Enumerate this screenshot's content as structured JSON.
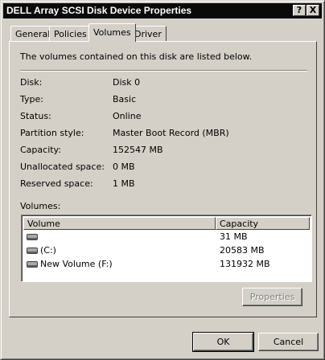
{
  "window": {
    "title": "DELL Array SCSI Disk Device Properties",
    "help_label": "?",
    "close_label": "X"
  },
  "tabs": [
    {
      "label": "General",
      "active": false
    },
    {
      "label": "Policies",
      "active": false
    },
    {
      "label": "Volumes",
      "active": true
    },
    {
      "label": "Driver",
      "active": false
    }
  ],
  "panel": {
    "intro": "The volumes contained on this disk are listed below.",
    "properties": [
      {
        "label": "Disk:",
        "value": "Disk 0"
      },
      {
        "label": "Type:",
        "value": "Basic"
      },
      {
        "label": "Status:",
        "value": "Online"
      },
      {
        "label": "Partition style:",
        "value": "Master Boot Record (MBR)"
      },
      {
        "label": "Capacity:",
        "value": "152547 MB"
      },
      {
        "label": "Unallocated space:",
        "value": "0 MB"
      },
      {
        "label": "Reserved space:",
        "value": "1 MB"
      }
    ],
    "volumes_label": "Volumes:",
    "columns": {
      "volume": "Volume",
      "capacity": "Capacity"
    },
    "volumes": [
      {
        "name": "",
        "capacity": "31 MB"
      },
      {
        "name": "(C:)",
        "capacity": "20583 MB"
      },
      {
        "name": "New Volume (F:)",
        "capacity": "131932 MB"
      }
    ],
    "properties_button": "Properties"
  },
  "footer": {
    "ok_label": "OK",
    "cancel_label": "Cancel"
  }
}
